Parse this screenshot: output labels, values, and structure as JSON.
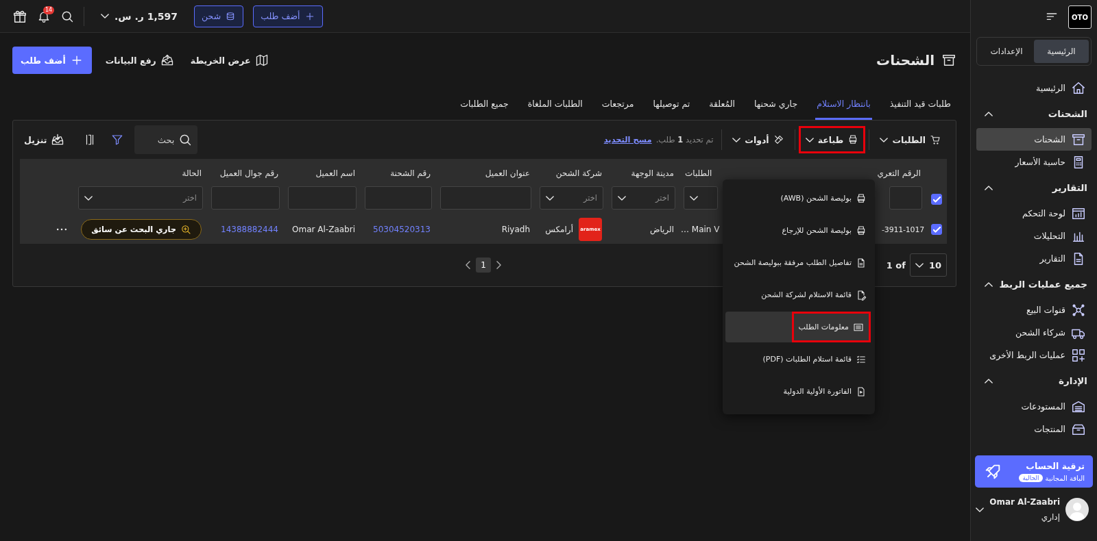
{
  "sidebar": {
    "logo": "OTO",
    "tabs": [
      {
        "label": "الرئيسية",
        "selected": true
      },
      {
        "label": "الإعدادات",
        "selected": false
      }
    ],
    "nav": [
      {
        "kind": "item",
        "label": "الرئيسية",
        "selected": false
      },
      {
        "kind": "section",
        "label": "الشحنات",
        "expanded": true,
        "children": [
          {
            "label": "الشحنات",
            "selected": true
          },
          {
            "label": "حاسبة الأسعار",
            "selected": false
          }
        ]
      },
      {
        "kind": "section",
        "label": "التقارير",
        "expanded": true,
        "children": [
          {
            "label": "لوحة التحكم",
            "selected": false
          },
          {
            "label": "التحليلات",
            "selected": false
          },
          {
            "label": "التقارير",
            "selected": false
          }
        ]
      },
      {
        "kind": "section",
        "label": "جميع عمليات الربط",
        "expanded": true,
        "children": [
          {
            "label": "قنوات البيع",
            "selected": false
          },
          {
            "label": "شركاء الشحن",
            "selected": false
          },
          {
            "label": "عمليات الربط الأخرى",
            "selected": false
          }
        ]
      },
      {
        "kind": "section",
        "label": "الإدارة",
        "expanded": true,
        "children": [
          {
            "label": "المستودعات",
            "selected": false
          },
          {
            "label": "المنتجات",
            "selected": false
          }
        ]
      }
    ],
    "upgrade": {
      "title": "ترقية الحساب",
      "plan": "الباقة المجانية",
      "badge": "الحالية"
    },
    "user": {
      "name": "Omar Al-Zaabri",
      "role": "إداري"
    }
  },
  "topbar": {
    "buttons": [
      {
        "label": "أضف طلب"
      },
      {
        "label": "شحن"
      }
    ],
    "balance": "1,597 ر. س.",
    "notifications": "14"
  },
  "page": {
    "title": "الشحنات",
    "actions": [
      {
        "kind": "link",
        "label": "عرض الخريطة"
      },
      {
        "kind": "link",
        "label": "رفع البيانات"
      },
      {
        "kind": "primary",
        "label": "أضف طلب"
      }
    ]
  },
  "tabs": [
    {
      "label": "طلبات قيد التنفيذ",
      "selected": false
    },
    {
      "label": "بانتظار الاستلام",
      "selected": true
    },
    {
      "label": "جاري شحنها",
      "selected": false
    },
    {
      "label": "المُعلقة",
      "selected": false
    },
    {
      "label": "تم توصيلها",
      "selected": false
    },
    {
      "label": "مرتجعات",
      "selected": false
    },
    {
      "label": "الطلبات الملغاة",
      "selected": false
    },
    {
      "label": "جميع الطلبات",
      "selected": false
    }
  ],
  "toolbar": {
    "menus": [
      {
        "label": "الطلبات",
        "expanded": false,
        "highlighted": false
      },
      {
        "label": "طباعة",
        "expanded": true,
        "highlighted": true,
        "items": [
          {
            "label": "بوليصة الشحن (AWB)",
            "selected": false,
            "highlighted": false
          },
          {
            "label": "بوليصة الشحن للإرجاع",
            "selected": false,
            "highlighted": false
          },
          {
            "label": "تفاصيل الطلب مرفقة ببوليصة الشحن",
            "selected": false,
            "highlighted": false
          },
          {
            "label": "قائمة الاستلام لشركة الشحن",
            "selected": false,
            "highlighted": false
          },
          {
            "label": "معلومات الطلب",
            "selected": true,
            "highlighted": true
          },
          {
            "label": "قائمة استلام الطلبات (PDF)",
            "selected": false,
            "highlighted": false
          },
          {
            "label": "الفاتورة الأولية الدولية",
            "selected": false,
            "highlighted": false
          }
        ]
      },
      {
        "label": "أدوات",
        "expanded": false,
        "highlighted": false
      }
    ],
    "selection_text": "تم تحديد **1** طلب.",
    "clear_link": "مسح التحديد",
    "search": {
      "placeholder": "بحث"
    },
    "download": "تنزيل"
  },
  "table": {
    "select_all_checked": true,
    "columns": [
      {
        "label": "الرقم التعري",
        "filter": {
          "kind": "text"
        }
      },
      {
        "label": "الطلبات",
        "filter": {
          "kind": "select"
        }
      },
      {
        "label": "مدينة الوجهة",
        "filter": {
          "kind": "select",
          "placeholder": "اختر"
        }
      },
      {
        "label": "شركة الشحن",
        "filter": {
          "kind": "select",
          "placeholder": "اختر"
        }
      },
      {
        "label": "عنوان العميل",
        "filter": {
          "kind": "text"
        }
      },
      {
        "label": "رقم الشحنة",
        "filter": {
          "kind": "text"
        }
      },
      {
        "label": "اسم العميل",
        "filter": {
          "kind": "text"
        }
      },
      {
        "label": "رقم جوال العميل",
        "filter": {
          "kind": "text"
        }
      },
      {
        "label": "الحالة",
        "filter": {
          "kind": "select",
          "placeholder": "اختر"
        }
      }
    ],
    "rows": [
      {
        "checked": true,
        "cells": [
          {
            "kind": "text",
            "text": "-3911-1017"
          },
          {
            "kind": "text",
            "text": "Main V …"
          },
          {
            "kind": "text",
            "text": "الرياض"
          },
          {
            "kind": "carrier",
            "logo_text": "aramex",
            "text": "أرامكس"
          },
          {
            "kind": "text",
            "text": "Riyadh"
          },
          {
            "kind": "link",
            "text": "50304520313"
          },
          {
            "kind": "text",
            "text": "Omar Al-Zaabri"
          },
          {
            "kind": "link",
            "text": "14388882444"
          },
          {
            "kind": "status",
            "text": "جاري البحث عن سائق"
          }
        ]
      }
    ]
  },
  "pagination": {
    "page_size": "10",
    "of_label": "1 of",
    "pages": [
      {
        "label": "1",
        "selected": true
      }
    ]
  }
}
